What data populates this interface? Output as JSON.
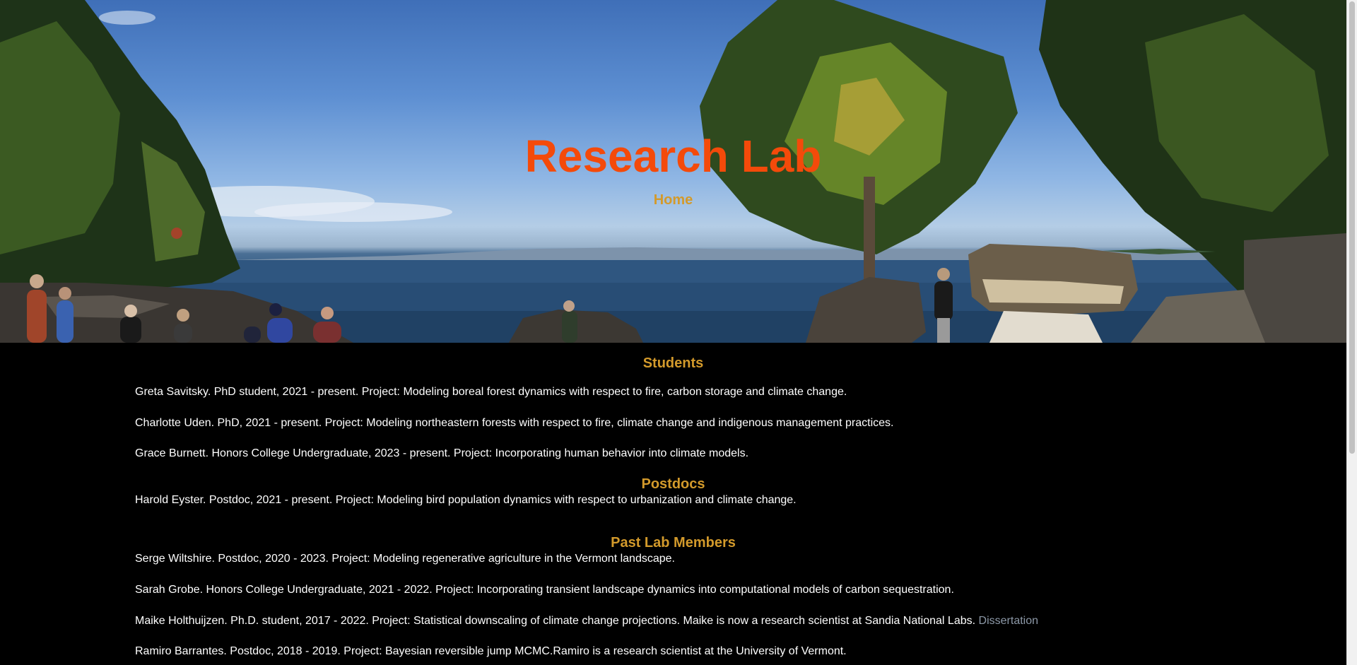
{
  "hero": {
    "title": "Research Lab",
    "nav": {
      "home_label": "Home"
    }
  },
  "sections": {
    "students": {
      "title": "Students",
      "members": [
        "Greta Savitsky. PhD student, 2021 - present. Project: Modeling boreal forest dynamics with respect to fire, carbon storage and climate change.",
        "Charlotte Uden. PhD, 2021 - present. Project: Modeling northeastern forests with respect to fire, climate change and indigenous management practices.",
        "Grace Burnett. Honors College Undergraduate, 2023 - present. Project: Incorporating human behavior into climate models."
      ]
    },
    "postdocs": {
      "title": "Postdocs",
      "members": [
        "Harold Eyster. Postdoc, 2021 - present. Project: Modeling bird population dynamics with respect to urbanization and climate change."
      ]
    },
    "past": {
      "title": "Past Lab Members",
      "members": [
        "Serge Wiltshire. Postdoc, 2020 - 2023. Project: Modeling regenerative agriculture in the Vermont landscape.",
        "Sarah Grobe. Honors College Undergraduate, 2021 - 2022. Project: Incorporating transient landscape dynamics into computational models of carbon sequestration.",
        "Maike Holthuijzen. Ph.D. student, 2017 - 2022. Project: Statistical downscaling of climate change projections. Maike is now a research scientist at Sandia National Labs.",
        "Ramiro Barrantes. Postdoc, 2018 - 2019. Project: Bayesian reversible jump MCMC.Ramiro is a research scientist at the University of Vermont."
      ],
      "dissertation_link": "Dissertation"
    }
  },
  "colors": {
    "title": "#f44a0a",
    "accent": "#d39a2b",
    "body_text": "#ffffff",
    "background": "#000000",
    "link": "#8d99a8"
  }
}
